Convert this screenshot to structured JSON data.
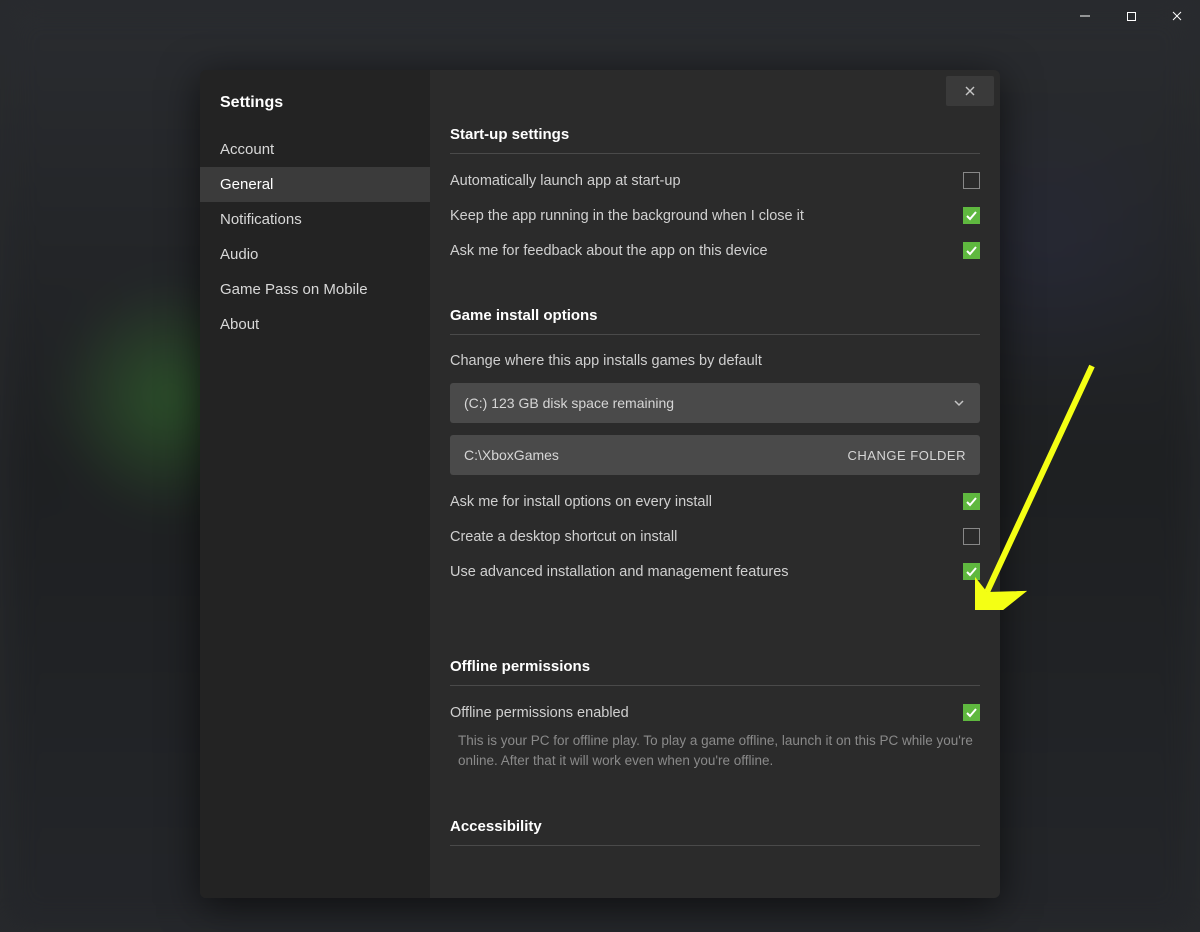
{
  "sidebar": {
    "title": "Settings",
    "items": [
      {
        "label": "Account"
      },
      {
        "label": "General"
      },
      {
        "label": "Notifications"
      },
      {
        "label": "Audio"
      },
      {
        "label": "Game Pass on Mobile"
      },
      {
        "label": "About"
      }
    ],
    "activeIndex": 1
  },
  "sections": {
    "startup": {
      "title": "Start-up settings",
      "items": [
        {
          "label": "Automatically launch app at start-up",
          "checked": false
        },
        {
          "label": "Keep the app running in the background when I close it",
          "checked": true
        },
        {
          "label": "Ask me for feedback about the app on this device",
          "checked": true
        }
      ]
    },
    "install": {
      "title": "Game install options",
      "desc": "Change where this app installs games by default",
      "drive": "(C:) 123 GB disk space remaining",
      "folder": "C:\\XboxGames",
      "changeFolder": "CHANGE FOLDER",
      "items": [
        {
          "label": "Ask me for install options on every install",
          "checked": true
        },
        {
          "label": "Create a desktop shortcut on install",
          "checked": false
        },
        {
          "label": "Use advanced installation and management features",
          "checked": true
        }
      ]
    },
    "offline": {
      "title": "Offline permissions",
      "item": {
        "label": "Offline permissions enabled",
        "checked": true
      },
      "desc": "This is your PC for offline play. To play a game offline, launch it on this PC while you're online. After that it will work even when you're offline."
    },
    "accessibility": {
      "title": "Accessibility"
    }
  }
}
